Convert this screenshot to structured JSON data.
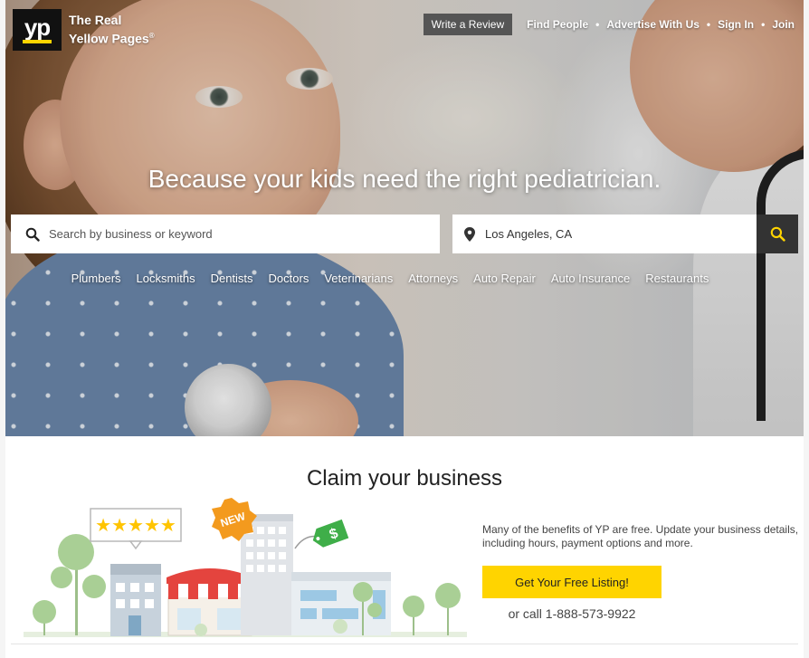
{
  "brand": {
    "logo_mark": "yp",
    "name_line1": "The Real",
    "name_line2": "Yellow Pages",
    "registered": "®"
  },
  "topnav": {
    "write_review": "Write a Review",
    "links": [
      "Find People",
      "Advertise With Us",
      "Sign In",
      "Join"
    ],
    "separator": "•"
  },
  "hero": {
    "headline": "Because your kids need the right pediatrician."
  },
  "search": {
    "what_placeholder": "Search by business or keyword",
    "where_value": "Los Angeles, CA",
    "search_icon": "search-icon",
    "location_icon": "map-pin-icon"
  },
  "categories": [
    "Plumbers",
    "Locksmiths",
    "Dentists",
    "Doctors",
    "Veterinarians",
    "Attorneys",
    "Auto Repair",
    "Auto Insurance",
    "Restaurants"
  ],
  "claim": {
    "title": "Claim your business",
    "description": "Many of the benefits of YP are free. Update your business details, including hours, payment options and more.",
    "cta": "Get Your Free Listing!",
    "call": "or call 1-888-573-9922",
    "badge_new": "NEW",
    "price_tag": "$",
    "stars": "★★★★★"
  },
  "colors": {
    "accent_yellow": "#ffd400",
    "dark": "#333333",
    "review_button": "#555555"
  }
}
